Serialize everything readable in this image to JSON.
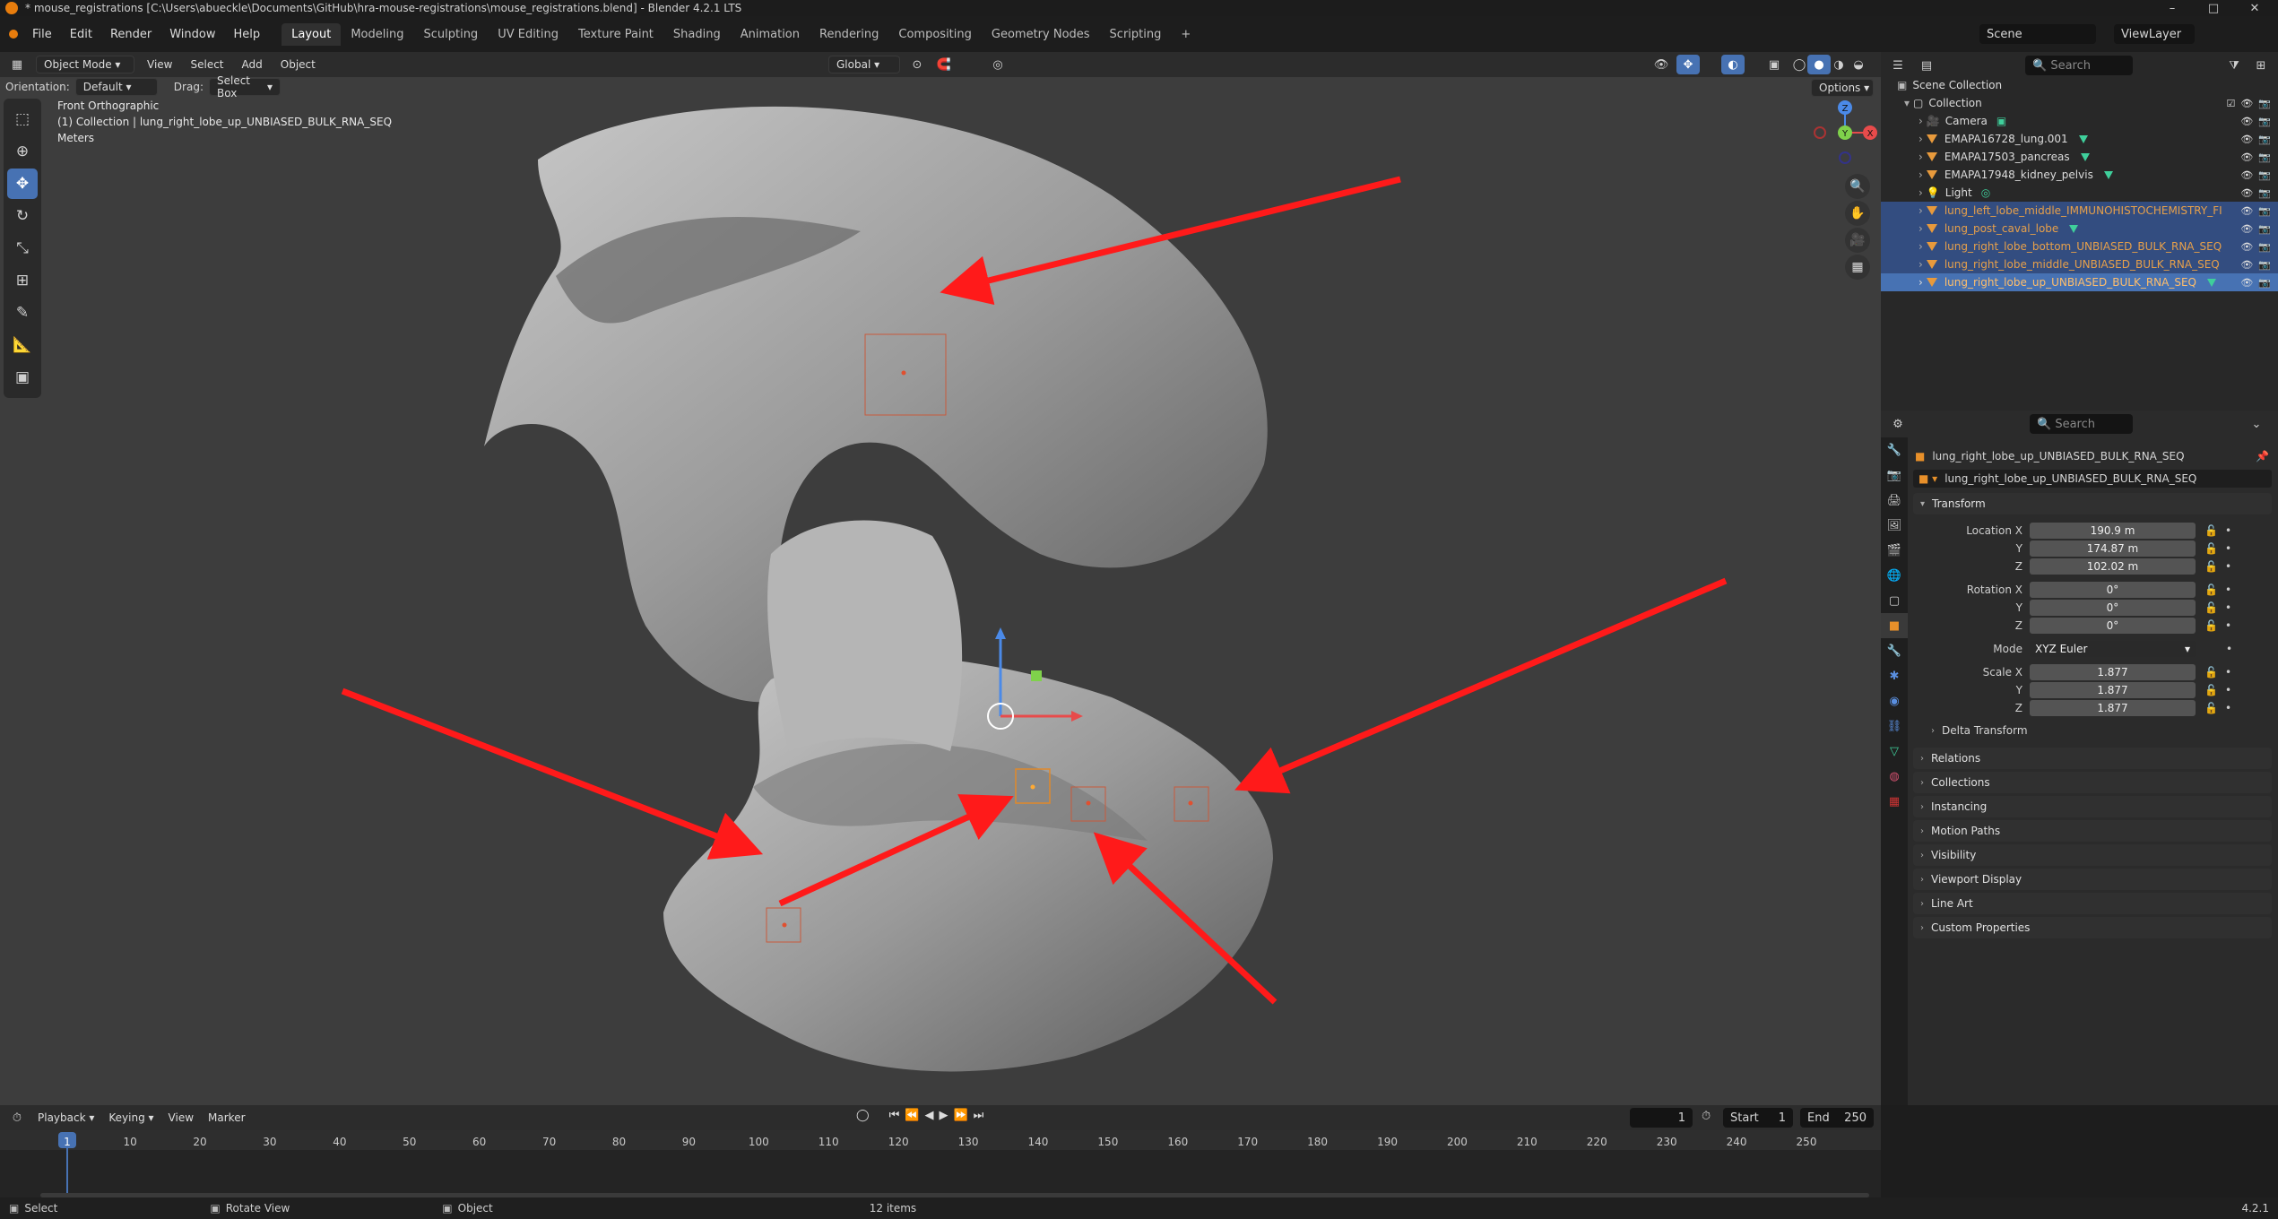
{
  "window": {
    "title": "* mouse_registrations [C:\\Users\\abueckle\\Documents\\GitHub\\hra-mouse-registrations\\mouse_registrations.blend] - Blender 4.2.1 LTS",
    "controls": [
      "–",
      "□",
      "✕"
    ]
  },
  "menu": [
    "File",
    "Edit",
    "Render",
    "Window",
    "Help"
  ],
  "workspaces": [
    "Layout",
    "Modeling",
    "Sculpting",
    "UV Editing",
    "Texture Paint",
    "Shading",
    "Animation",
    "Rendering",
    "Compositing",
    "Geometry Nodes",
    "Scripting"
  ],
  "workspace_add": "+",
  "scene": {
    "label": "Scene",
    "view_layer": "ViewLayer"
  },
  "viewport": {
    "mode": "Object Mode",
    "menus": [
      "View",
      "Select",
      "Add",
      "Object"
    ],
    "transform_orientation": "Global",
    "orientation_label": "Orientation:",
    "orientation_value": "Default",
    "drag_label": "Drag:",
    "drag_value": "Select Box",
    "options": "Options",
    "overlay_line1": "Front Orthographic",
    "overlay_line2": "(1) Collection | lung_right_lobe_up_UNBIASED_BULK_RNA_SEQ",
    "overlay_line3": "Meters",
    "gizmo_axes": [
      "Z",
      "Y",
      "X"
    ]
  },
  "outliner": {
    "search_placeholder": "Search",
    "root": "Scene Collection",
    "collection": "Collection",
    "items": [
      {
        "name": "Camera",
        "type": "camera"
      },
      {
        "name": "EMAPA16728_lung.001",
        "type": "mesh"
      },
      {
        "name": "EMAPA17503_pancreas",
        "type": "mesh"
      },
      {
        "name": "EMAPA17948_kidney_pelvis",
        "type": "mesh"
      },
      {
        "name": "Light",
        "type": "light"
      },
      {
        "name": "lung_left_lobe_middle_IMMUNOHISTOCHEMISTRY_FI",
        "type": "mesh",
        "state": "selected"
      },
      {
        "name": "lung_post_caval_lobe",
        "type": "mesh",
        "state": "selected"
      },
      {
        "name": "lung_right_lobe_bottom_UNBIASED_BULK_RNA_SEQ",
        "type": "mesh",
        "state": "selected"
      },
      {
        "name": "lung_right_lobe_middle_UNBIASED_BULK_RNA_SEQ",
        "type": "mesh",
        "state": "selected"
      },
      {
        "name": "lung_right_lobe_up_UNBIASED_BULK_RNA_SEQ",
        "type": "mesh",
        "state": "active"
      }
    ]
  },
  "properties": {
    "search_placeholder": "Search",
    "object_name": "lung_right_lobe_up_UNBIASED_BULK_RNA_SEQ",
    "object_field": "lung_right_lobe_up_UNBIASED_BULK_RNA_SEQ",
    "transform_title": "Transform",
    "location_label": "Location X",
    "location": [
      "190.9 m",
      "174.87 m",
      "102.02 m"
    ],
    "rotation_label": "Rotation X",
    "rotation": [
      "0°",
      "0°",
      "0°"
    ],
    "mode_label": "Mode",
    "mode_value": "XYZ Euler",
    "scale_label": "Scale X",
    "scale": [
      "1.877",
      "1.877",
      "1.877"
    ],
    "axis_y": "Y",
    "axis_z": "Z",
    "delta_transform": "Delta Transform",
    "panels": [
      "Relations",
      "Collections",
      "Instancing",
      "Motion Paths",
      "Visibility",
      "Viewport Display",
      "Line Art",
      "Custom Properties"
    ]
  },
  "timeline": {
    "menus": [
      "Playback",
      "Keying",
      "View",
      "Marker"
    ],
    "current_frame": "1",
    "start_label": "Start",
    "start": "1",
    "end_label": "End",
    "end": "250",
    "ticks": [
      "1",
      "10",
      "20",
      "30",
      "40",
      "50",
      "60",
      "70",
      "80",
      "90",
      "100",
      "110",
      "120",
      "130",
      "140",
      "150",
      "160",
      "170",
      "180",
      "190",
      "200",
      "210",
      "220",
      "230",
      "240",
      "250"
    ]
  },
  "statusbar": {
    "select": "Select",
    "rotate_view": "Rotate View",
    "object": "Object",
    "items": "12 items",
    "version": "4.2.1"
  },
  "colors": {
    "accent": "#4772b3",
    "selected_row": "#334d80",
    "lung_text": "#e7a04a",
    "arrow": "#ff1a1a",
    "mesh": "#9a9a9a"
  }
}
